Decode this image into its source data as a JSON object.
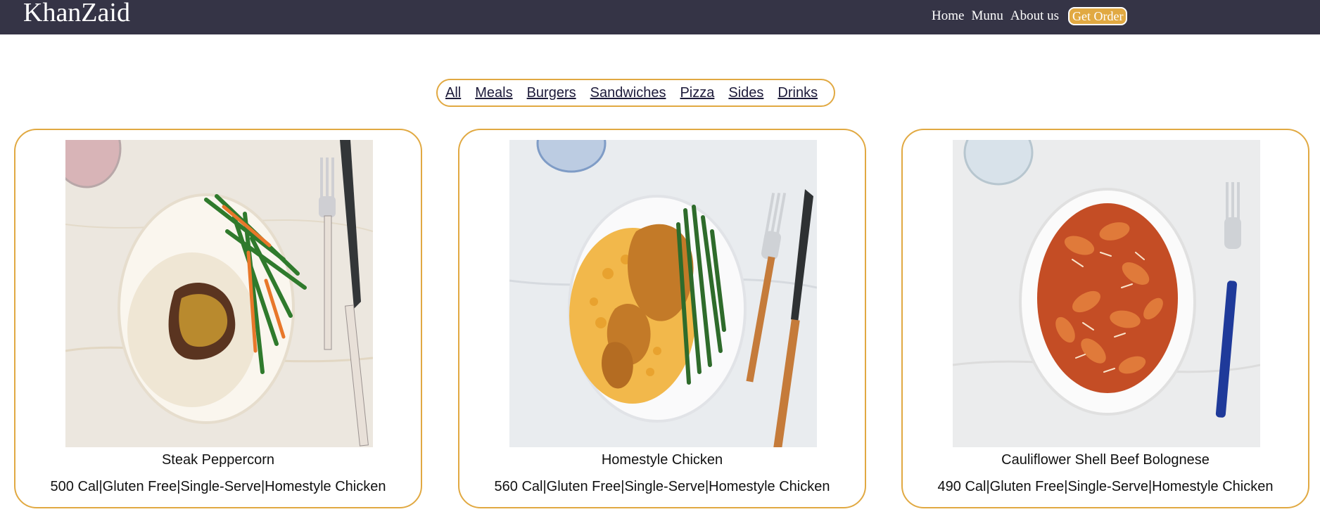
{
  "header": {
    "brand": "KhanZaid",
    "nav": {
      "home": "Home",
      "menu": "Munu",
      "about": "About us",
      "order": "Get Order"
    }
  },
  "filters": [
    "All",
    "Meals",
    "Burgers",
    "Sandwiches",
    "Pizza",
    "Sides",
    "Drinks"
  ],
  "cards": [
    {
      "title": "Steak Peppercorn",
      "meta": "500 Cal|Gluten Free|Single-Serve|Homestyle Chicken"
    },
    {
      "title": "Homestyle Chicken",
      "meta": "560 Cal|Gluten Free|Single-Serve|Homestyle Chicken"
    },
    {
      "title": "Cauliflower Shell Beef Bolognese",
      "meta": "490 Cal|Gluten Free|Single-Serve|Homestyle Chicken"
    }
  ],
  "colors": {
    "header_bg": "#353446",
    "accent": "#e1a942"
  }
}
